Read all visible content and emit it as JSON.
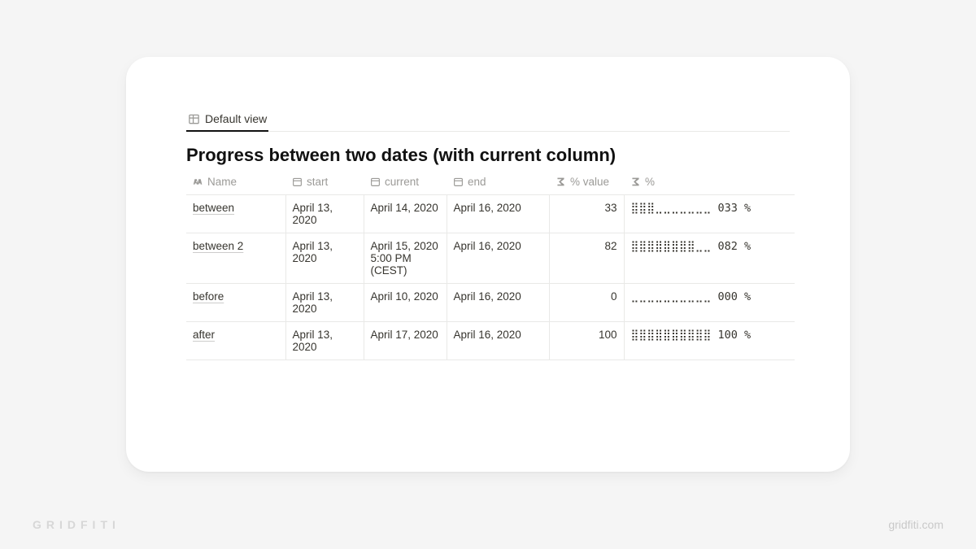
{
  "tabs": {
    "default_view": "Default view"
  },
  "title": "Progress between two dates (with current column)",
  "columns": {
    "name": "Name",
    "start": "start",
    "current": "current",
    "end": "end",
    "pvalue": "% value",
    "pct": "%"
  },
  "rows": [
    {
      "name": "between",
      "start": "April 13, 2020",
      "current": "April 14, 2020",
      "end": "April 16, 2020",
      "pvalue": "33",
      "pct": "⣿⣿⣿⣀⣀⣀⣀⣀⣀⣀ 033 %"
    },
    {
      "name": "between 2",
      "start": "April 13, 2020",
      "current": "April 15, 2020 5:00 PM (CEST)",
      "end": "April 16, 2020",
      "pvalue": "82",
      "pct": "⣿⣿⣿⣿⣿⣿⣿⣿⣀⣀ 082 %"
    },
    {
      "name": "before",
      "start": "April 13, 2020",
      "current": "April 10, 2020",
      "end": "April 16, 2020",
      "pvalue": "0",
      "pct": "⣀⣀⣀⣀⣀⣀⣀⣀⣀⣀ 000 %"
    },
    {
      "name": "after",
      "start": "April 13, 2020",
      "current": "April 17, 2020",
      "end": "April 16, 2020",
      "pvalue": "100",
      "pct": "⣿⣿⣿⣿⣿⣿⣿⣿⣿⣿ 100 %"
    }
  ],
  "watermark": {
    "brand": "GRIDFITI",
    "url": "gridfiti.com"
  }
}
